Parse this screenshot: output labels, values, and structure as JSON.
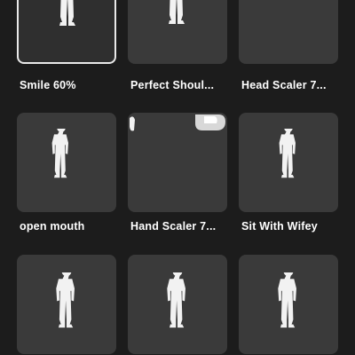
{
  "items": [
    {
      "label": "Smile 60%",
      "selected": true,
      "icon": "avatar-figure"
    },
    {
      "label": "Perfect Shoul...",
      "selected": false,
      "icon": "avatar-figure"
    },
    {
      "label": "Head Scaler 7...",
      "selected": false,
      "icon": "empty"
    },
    {
      "label": "open mouth",
      "selected": false,
      "icon": "avatar-figure"
    },
    {
      "label": "Hand Scaler 7...",
      "selected": false,
      "icon": "hand-pieces"
    },
    {
      "label": "Sit With Wifey",
      "selected": false,
      "icon": "avatar-figure"
    },
    {
      "label": "",
      "selected": false,
      "icon": "avatar-figure"
    },
    {
      "label": "",
      "selected": false,
      "icon": "avatar-figure"
    },
    {
      "label": "",
      "selected": false,
      "icon": "avatar-figure"
    }
  ],
  "colors": {
    "background": "#1c1c1c",
    "tile": "#3a3a3a",
    "selected_border": "#e9e9e9",
    "figure": "#f2f2f2"
  }
}
